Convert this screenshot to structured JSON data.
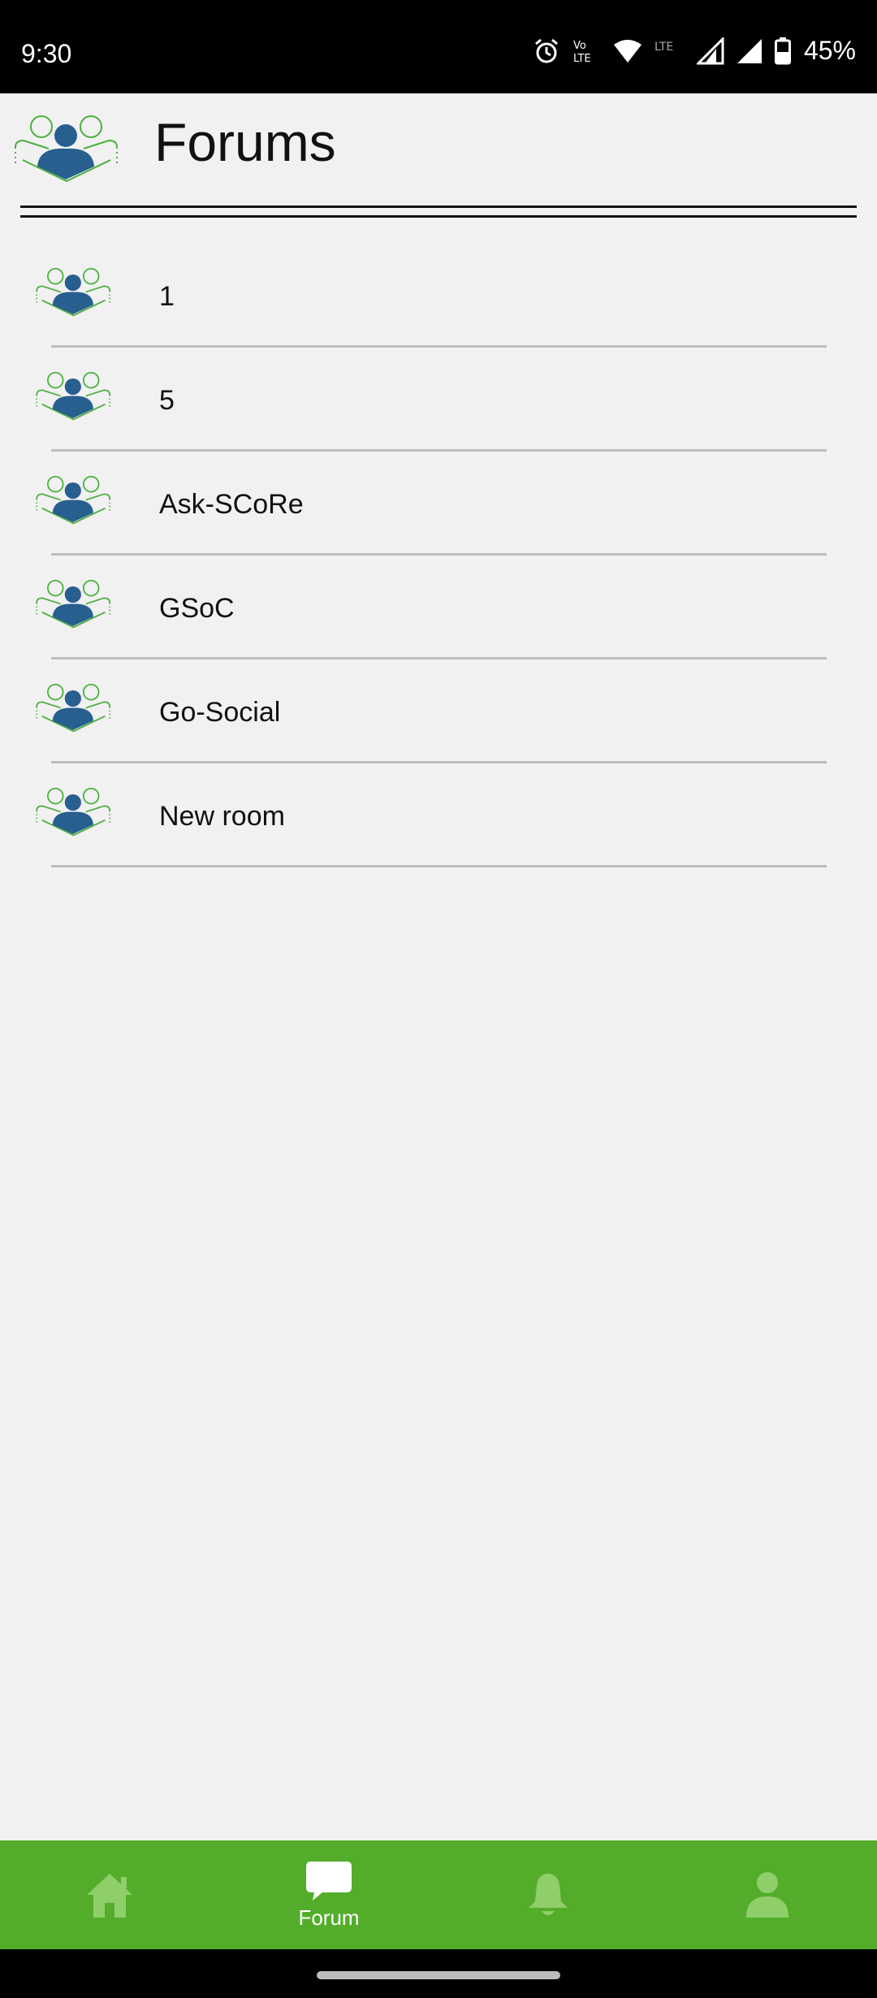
{
  "status_bar": {
    "time": "9:30",
    "battery": "45%",
    "icons": [
      "alarm-icon",
      "volte-icon",
      "wifi-icon",
      "lte-icon",
      "signal-icon",
      "signal-icon",
      "battery-icon"
    ]
  },
  "header": {
    "title": "Forums",
    "logo_icon": "forum-group-icon"
  },
  "forums": [
    {
      "name": "1"
    },
    {
      "name": "5"
    },
    {
      "name": "Ask-SCoRe"
    },
    {
      "name": "GSoC"
    },
    {
      "name": "Go-Social"
    },
    {
      "name": "New room"
    }
  ],
  "bottom_nav": {
    "items": [
      {
        "icon": "home-icon",
        "label": ""
      },
      {
        "icon": "chat-bubble-icon",
        "label": "Forum",
        "active": true
      },
      {
        "icon": "bell-icon",
        "label": ""
      },
      {
        "icon": "user-icon",
        "label": ""
      }
    ]
  },
  "colors": {
    "accent_green": "#53ad2a",
    "icon_blue": "#275f8f",
    "icon_green": "#4caf3e",
    "background": "#f1f1f1"
  }
}
